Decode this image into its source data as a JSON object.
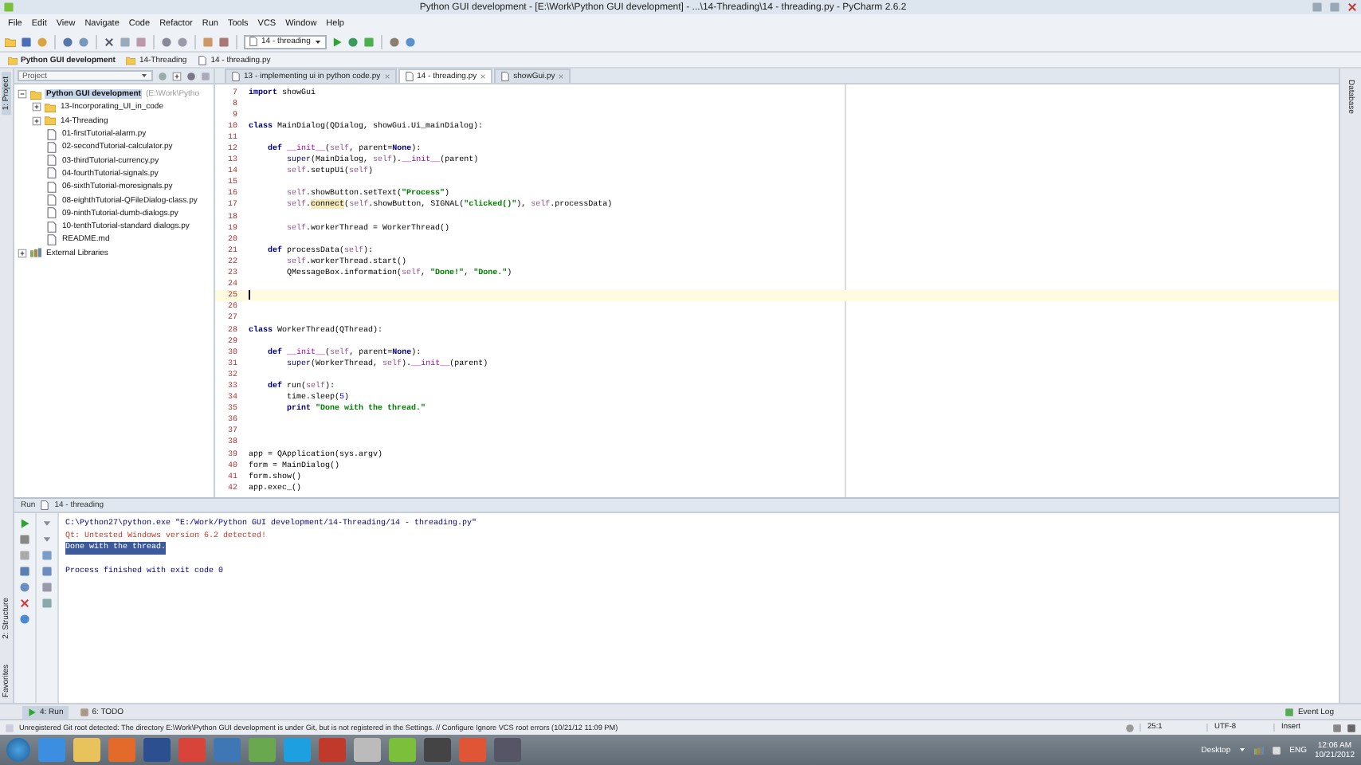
{
  "window": {
    "title": "Python GUI development - [E:\\Work\\Python GUI development] - ...\\14-Threading\\14 - threading.py - PyCharm 2.6.2"
  },
  "menu": [
    "File",
    "Edit",
    "View",
    "Navigate",
    "Code",
    "Refactor",
    "Run",
    "Tools",
    "VCS",
    "Window",
    "Help"
  ],
  "toolbar": {
    "run_config": "14 - threading"
  },
  "breadcrumbs": [
    {
      "label": "Python GUI development",
      "kind": "project"
    },
    {
      "label": "14-Threading",
      "kind": "folder"
    },
    {
      "label": "14 - threading.py",
      "kind": "file"
    }
  ],
  "side_tabs": {
    "left": [
      {
        "label": "1: Project",
        "selected": true
      },
      {
        "label": "2: Structure",
        "selected": false
      },
      {
        "label": "Favorites",
        "selected": false
      }
    ],
    "right": [
      {
        "label": "Database",
        "selected": false
      }
    ]
  },
  "project": {
    "title": "Project",
    "tree": [
      {
        "label": "Python GUI development",
        "path": "(E:\\Work\\Pytho",
        "kind": "folder",
        "expanded": true,
        "selected": true,
        "children": [
          {
            "label": "13-Incorporating_UI_in_code",
            "kind": "folder",
            "expanded": false,
            "selected": false
          },
          {
            "label": "14-Threading",
            "kind": "folder",
            "expanded": false,
            "selected": false
          },
          {
            "label": "01-firstTutorial-alarm.py",
            "kind": "python",
            "selected": false
          },
          {
            "label": "02-secondTutorial-calculator.py",
            "kind": "python",
            "selected": false
          },
          {
            "label": "03-thirdTutorial-currency.py",
            "kind": "python",
            "selected": false
          },
          {
            "label": "04-fourthTutorial-signals.py",
            "kind": "python",
            "selected": false
          },
          {
            "label": "06-sixthTutorial-moresignals.py",
            "kind": "python",
            "selected": false
          },
          {
            "label": "08-eighthTutorial-QFileDialog-class.py",
            "kind": "python",
            "selected": false
          },
          {
            "label": "09-ninthTutorial-dumb-dialogs.py",
            "kind": "python",
            "selected": false
          },
          {
            "label": "10-tenthTutorial-standard dialogs.py",
            "kind": "python",
            "selected": false
          },
          {
            "label": "README.md",
            "kind": "text",
            "selected": false
          }
        ]
      },
      {
        "label": "External Libraries",
        "kind": "library",
        "expanded": false,
        "selected": false
      }
    ]
  },
  "editor": {
    "tabs": [
      {
        "label": "13 - implementing ui in python code.py",
        "selected": false
      },
      {
        "label": "14 - threading.py",
        "selected": true
      },
      {
        "label": "showGui.py",
        "selected": false
      }
    ],
    "lines": [
      {
        "number": "7",
        "current": false,
        "segments": [
          {
            "kind": "kw",
            "text": "import"
          },
          {
            "kind": "plain",
            "text": " showGui"
          }
        ]
      },
      {
        "number": "8",
        "current": false
      },
      {
        "number": "9",
        "current": false
      },
      {
        "number": "10",
        "current": false,
        "segments": [
          {
            "kind": "kw",
            "text": "class"
          },
          {
            "kind": "plain",
            "text": " MainDialog(QDialog, showGui.Ui_mainDialog):"
          }
        ]
      },
      {
        "number": "11",
        "current": false
      },
      {
        "number": "12",
        "current": false,
        "segments": [
          {
            "kind": "kw",
            "text": "    def"
          },
          {
            "kind": "magic",
            "text": " __init__"
          },
          {
            "kind": "plain",
            "text": "("
          },
          {
            "kind": "self",
            "text": "self"
          },
          {
            "kind": "plain",
            "text": ", parent="
          },
          {
            "kind": "kw",
            "text": "None"
          },
          {
            "kind": "plain",
            "text": "):"
          }
        ]
      },
      {
        "number": "13",
        "current": false,
        "segments": [
          {
            "kind": "builtin",
            "text": "        super"
          },
          {
            "kind": "plain",
            "text": "(MainDialog, "
          },
          {
            "kind": "self",
            "text": "self"
          },
          {
            "kind": "plain",
            "text": ")."
          },
          {
            "kind": "magic",
            "text": "__init__"
          },
          {
            "kind": "plain",
            "text": "(parent)"
          }
        ]
      },
      {
        "number": "14",
        "current": false,
        "segments": [
          {
            "kind": "self",
            "text": "        self"
          },
          {
            "kind": "plain",
            "text": ".setupUi("
          },
          {
            "kind": "self",
            "text": "self"
          },
          {
            "kind": "plain",
            "text": ")"
          }
        ]
      },
      {
        "number": "15",
        "current": false
      },
      {
        "number": "16",
        "current": false,
        "segments": [
          {
            "kind": "self",
            "text": "        self"
          },
          {
            "kind": "plain",
            "text": ".showButton.setText("
          },
          {
            "kind": "str",
            "text": "\"Process\""
          },
          {
            "kind": "plain",
            "text": ")"
          }
        ]
      },
      {
        "number": "17",
        "current": false,
        "segments": [
          {
            "kind": "self",
            "text": "        self"
          },
          {
            "kind": "plain",
            "text": "."
          },
          {
            "kind": "warn",
            "text": "connect"
          },
          {
            "kind": "plain",
            "text": "("
          },
          {
            "kind": "self",
            "text": "self"
          },
          {
            "kind": "plain",
            "text": ".showButton, SIGNAL("
          },
          {
            "kind": "str",
            "text": "\"clicked()\""
          },
          {
            "kind": "plain",
            "text": "), "
          },
          {
            "kind": "self",
            "text": "self"
          },
          {
            "kind": "plain",
            "text": ".processData)"
          }
        ]
      },
      {
        "number": "18",
        "current": false
      },
      {
        "number": "19",
        "current": false,
        "segments": [
          {
            "kind": "self",
            "text": "        self"
          },
          {
            "kind": "plain",
            "text": ".workerThread = WorkerThread()"
          }
        ]
      },
      {
        "number": "20",
        "current": false
      },
      {
        "number": "21",
        "current": false,
        "segments": [
          {
            "kind": "kw",
            "text": "    def"
          },
          {
            "kind": "plain",
            "text": " processData("
          },
          {
            "kind": "self",
            "text": "self"
          },
          {
            "kind": "plain",
            "text": "):"
          }
        ]
      },
      {
        "number": "22",
        "current": false,
        "segments": [
          {
            "kind": "self",
            "text": "        self"
          },
          {
            "kind": "plain",
            "text": ".workerThread.start()"
          }
        ]
      },
      {
        "number": "23",
        "current": false,
        "segments": [
          {
            "kind": "plain",
            "text": "        QMessageBox.information("
          },
          {
            "kind": "self",
            "text": "self"
          },
          {
            "kind": "plain",
            "text": ", "
          },
          {
            "kind": "str",
            "text": "\"Done!\""
          },
          {
            "kind": "plain",
            "text": ", "
          },
          {
            "kind": "str",
            "text": "\"Done.\""
          },
          {
            "kind": "plain",
            "text": ")"
          }
        ]
      },
      {
        "number": "24",
        "current": false
      },
      {
        "number": "25",
        "current": true
      },
      {
        "number": "26",
        "current": false
      },
      {
        "number": "27",
        "current": false
      },
      {
        "number": "28",
        "current": false,
        "segments": [
          {
            "kind": "kw",
            "text": "class"
          },
          {
            "kind": "plain",
            "text": " WorkerThread(QThread):"
          }
        ]
      },
      {
        "number": "29",
        "current": false
      },
      {
        "number": "30",
        "current": false,
        "segments": [
          {
            "kind": "kw",
            "text": "    def"
          },
          {
            "kind": "magic",
            "text": " __init__"
          },
          {
            "kind": "plain",
            "text": "("
          },
          {
            "kind": "self",
            "text": "self"
          },
          {
            "kind": "plain",
            "text": ", parent="
          },
          {
            "kind": "kw",
            "text": "None"
          },
          {
            "kind": "plain",
            "text": "):"
          }
        ]
      },
      {
        "number": "31",
        "current": false,
        "segments": [
          {
            "kind": "builtin",
            "text": "        super"
          },
          {
            "kind": "plain",
            "text": "(WorkerThread, "
          },
          {
            "kind": "self",
            "text": "self"
          },
          {
            "kind": "plain",
            "text": ")."
          },
          {
            "kind": "magic",
            "text": "__init__"
          },
          {
            "kind": "plain",
            "text": "(parent)"
          }
        ]
      },
      {
        "number": "32",
        "current": false
      },
      {
        "number": "33",
        "current": false,
        "segments": [
          {
            "kind": "kw",
            "text": "    def"
          },
          {
            "kind": "plain",
            "text": " run("
          },
          {
            "kind": "self",
            "text": "self"
          },
          {
            "kind": "plain",
            "text": "):"
          }
        ]
      },
      {
        "number": "34",
        "current": false,
        "segments": [
          {
            "kind": "plain",
            "text": "        time.sleep("
          },
          {
            "kind": "num",
            "text": "5"
          },
          {
            "kind": "plain",
            "text": ")"
          }
        ]
      },
      {
        "number": "35",
        "current": false,
        "segments": [
          {
            "kind": "kw",
            "text": "        print"
          },
          {
            "kind": "str",
            "text": " \"Done with the thread.\""
          }
        ]
      },
      {
        "number": "36",
        "current": false
      },
      {
        "number": "37",
        "current": false
      },
      {
        "number": "38",
        "current": false
      },
      {
        "number": "39",
        "current": false,
        "segments": [
          {
            "kind": "plain",
            "text": "app = QApplication(sys.argv)"
          }
        ]
      },
      {
        "number": "40",
        "current": false,
        "segments": [
          {
            "kind": "plain",
            "text": "form = MainDialog()"
          }
        ]
      },
      {
        "number": "41",
        "current": false,
        "segments": [
          {
            "kind": "plain",
            "text": "form.show()"
          }
        ]
      },
      {
        "number": "42",
        "current": false,
        "segments": [
          {
            "kind": "plain",
            "text": "app.exec_()"
          }
        ]
      }
    ]
  },
  "run_panel": {
    "title": "Run",
    "config": "14 - threading",
    "output": [
      {
        "kind": "command",
        "text": "C:\\Python27\\python.exe \"E:/Work/Python GUI development/14-Threading/14 - threading.py\"",
        "selected": false
      },
      {
        "kind": "stderr",
        "text": "Qt: Untested Windows version 6.2 detected!",
        "selected": false
      },
      {
        "kind": "stdout",
        "text": "Done with the thread.",
        "selected": true
      },
      {
        "kind": "system",
        "text": "Process finished with exit code 0",
        "selected": false
      }
    ]
  },
  "tool_tabs": [
    {
      "label": "4: Run",
      "selected": true
    },
    {
      "label": "6: TODO",
      "selected": false
    }
  ],
  "event_log": "Event Log",
  "status_bar": {
    "message": "Unregistered Git root detected: The directory E:\\Work\\Python GUI development is under Git, but is not registered in the Settings. // Configure  Ignore VCS root errors (10/21/12 11:09 PM)",
    "position": "25:1",
    "encoding": "UTF-8",
    "mode": "Insert"
  },
  "taskbar": {
    "desktop": "Desktop",
    "language": "ENG",
    "time": "12:06 AM",
    "date": "10/21/2012"
  }
}
